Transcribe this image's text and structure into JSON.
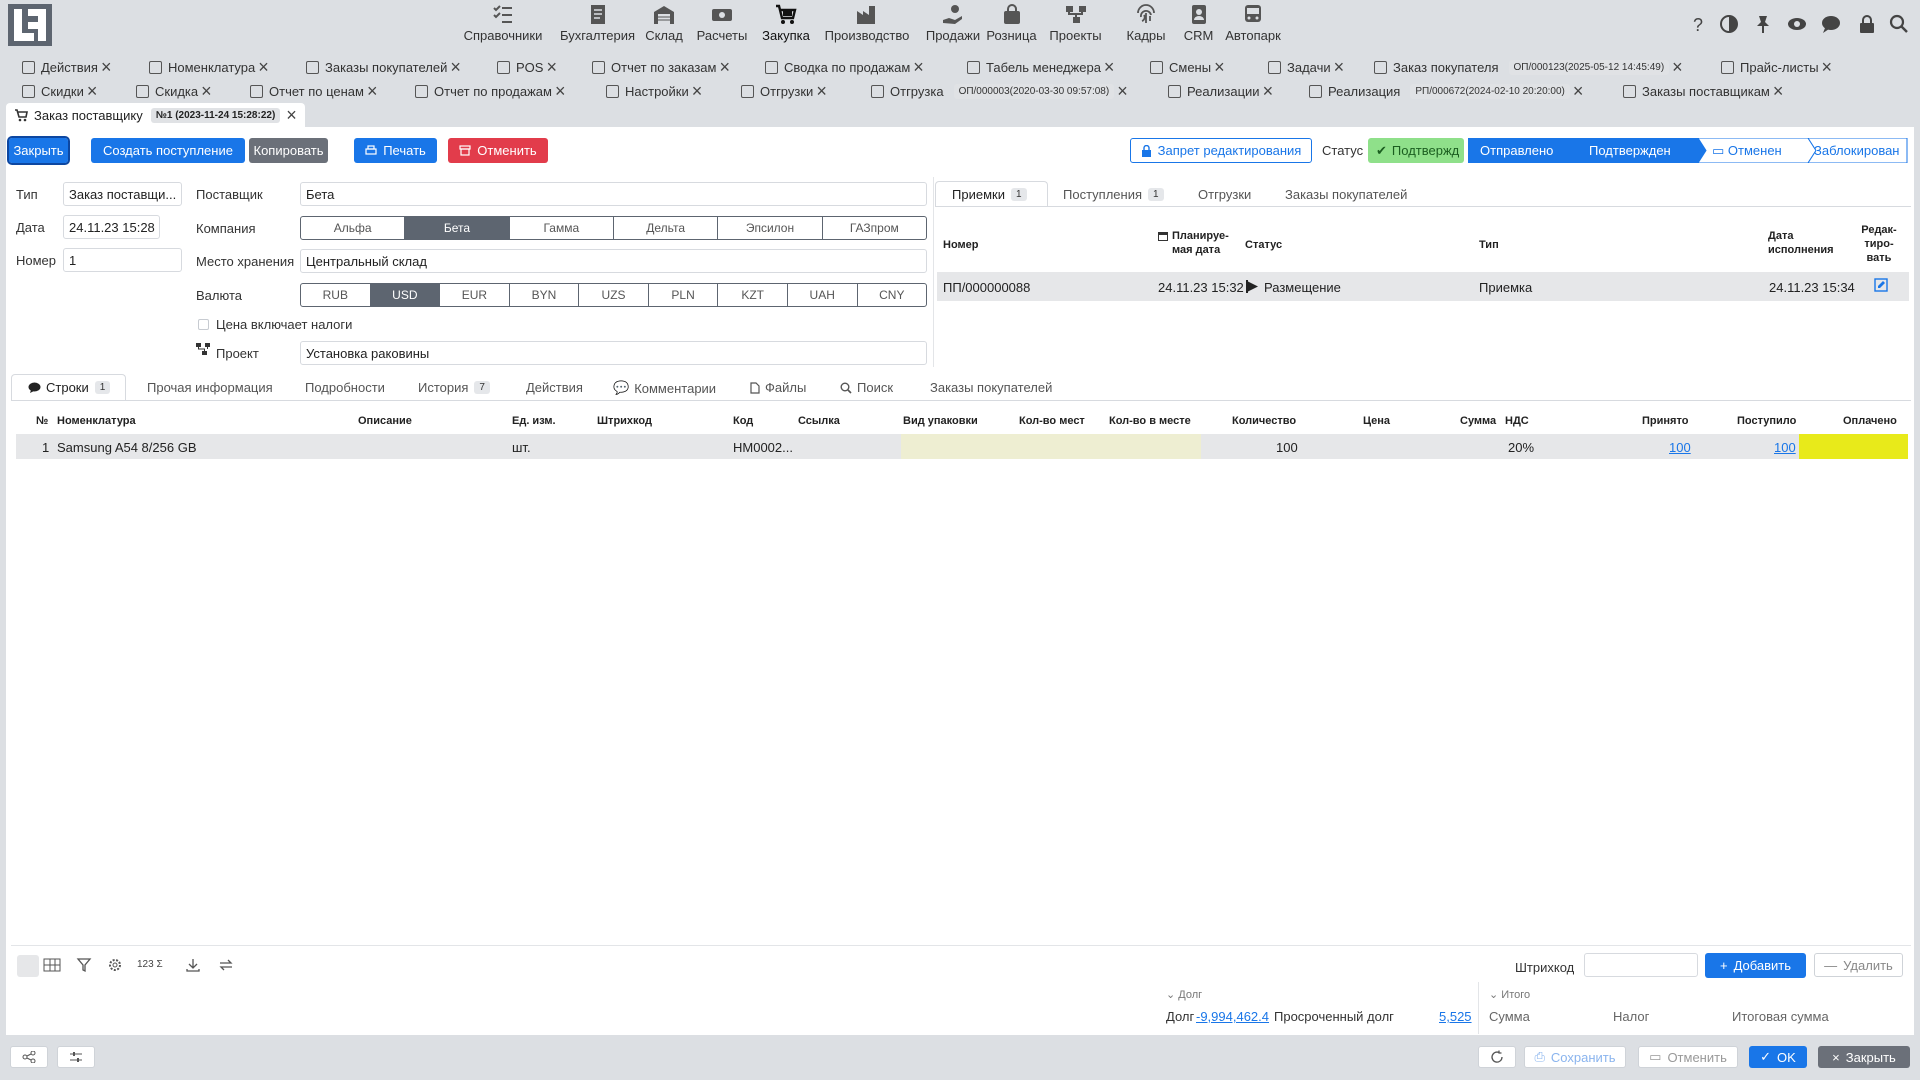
{
  "nav": {
    "items": [
      {
        "label": "Справочники",
        "icon": "list-check-icon"
      },
      {
        "label": "Бухгалтерия",
        "icon": "ledger-icon"
      },
      {
        "label": "Склад",
        "icon": "warehouse-icon"
      },
      {
        "label": "Расчеты",
        "icon": "money-icon"
      },
      {
        "label": "Закупка",
        "icon": "cart-icon"
      },
      {
        "label": "Производство",
        "icon": "factory-icon"
      },
      {
        "label": "Продажи",
        "icon": "hand-money-icon"
      },
      {
        "label": "Розница",
        "icon": "bag-icon"
      },
      {
        "label": "Проекты",
        "icon": "project-icon"
      },
      {
        "label": "Кадры",
        "icon": "fingerprint-icon"
      },
      {
        "label": "CRM",
        "icon": "contact-icon"
      },
      {
        "label": "Автопарк",
        "icon": "bus-icon"
      }
    ]
  },
  "doc_tabs": {
    "row1": [
      {
        "label": "Действия"
      },
      {
        "label": "Номенклатура"
      },
      {
        "label": "Заказы покупателей"
      },
      {
        "label": "POS"
      },
      {
        "label": "Отчет по заказам"
      },
      {
        "label": "Сводка по продажам"
      },
      {
        "label": "Табель менеджера"
      },
      {
        "label": "Смены"
      },
      {
        "label": "Задачи"
      },
      {
        "label": "Заказ покупателя",
        "badge": "ОП/000123(2025-05-12 14:45:49)"
      },
      {
        "label": "Прайс-листы"
      }
    ],
    "row2": [
      {
        "label": "Скидки"
      },
      {
        "label": "Скидка"
      },
      {
        "label": "Отчет по ценам"
      },
      {
        "label": "Отчет по продажам"
      },
      {
        "label": "Настройки"
      },
      {
        "label": "Отгрузки"
      },
      {
        "label": "Отгрузка",
        "badge": "ОП/000003(2020-03-30 09:57:08)"
      },
      {
        "label": "Реализации"
      },
      {
        "label": "Реализация",
        "badge": "РП/000672(2024-02-10 20:20:00)"
      },
      {
        "label": "Заказы поставщикам"
      }
    ],
    "current": {
      "label": "Заказ поставщику",
      "badge": "№1 (2023-11-24 15:28:22)"
    }
  },
  "toolbar": {
    "close": "Закрыть",
    "create_receipt": "Создать поступление",
    "copy": "Копировать",
    "print": "Печать",
    "cancel": "Отменить",
    "edit_lock": "Запрет редактирования",
    "status_label": "Статус",
    "status_value": "Подтвержд",
    "steps": [
      "Отправлено",
      "Подтвержден",
      "Отменен",
      "Заблокирован"
    ]
  },
  "form": {
    "type_label": "Тип",
    "type_value": "Заказ поставщи...",
    "date_label": "Дата",
    "date_value": "24.11.23 15:28",
    "number_label": "Номер",
    "number_value": "1",
    "supplier_label": "Поставщик",
    "supplier_value": "Бета",
    "company_label": "Компания",
    "companies": [
      "Альфа",
      "Бета",
      "Гамма",
      "Дельта",
      "Эпсилон",
      "ГАЗпром"
    ],
    "company_selected": "Бета",
    "storage_label": "Место хранения",
    "storage_value": "Центральный склад",
    "currency_label": "Валюта",
    "currencies": [
      "RUB",
      "USD",
      "EUR",
      "BYN",
      "UZS",
      "PLN",
      "KZT",
      "UAH",
      "CNY"
    ],
    "currency_selected": "USD",
    "tax_included": "Цена включает налоги",
    "project_label": "Проект",
    "project_value": "Установка раковины"
  },
  "right_tabs": [
    {
      "label": "Приемки",
      "count": "1"
    },
    {
      "label": "Поступления",
      "count": "1"
    },
    {
      "label": "Отгрузки"
    },
    {
      "label": "Заказы покупателей"
    }
  ],
  "receipts_table": {
    "headers": {
      "number": "Номер",
      "planned": "Планируе-мая дата",
      "status": "Статус",
      "type": "Тип",
      "exec_date": "Дата исполнения",
      "edit": "Редак-тиро-вать"
    },
    "row": {
      "number": "ПП/000000088",
      "planned": "24.11.23 15:32",
      "status": "Размещение",
      "type": "Приемка",
      "exec_date": "24.11.23 15:34"
    }
  },
  "bottom_tabs": [
    {
      "label": "Строки",
      "count": "1"
    },
    {
      "label": "Прочая информация"
    },
    {
      "label": "Подробности"
    },
    {
      "label": "История",
      "count": "7"
    },
    {
      "label": "Действия"
    },
    {
      "label": "Комментарии"
    },
    {
      "label": "Файлы"
    },
    {
      "label": "Поиск"
    },
    {
      "label": "Заказы покупателей"
    }
  ],
  "lines_table": {
    "headers": {
      "no": "№",
      "item": "Номенклатура",
      "desc": "Описание",
      "unit": "Ед. изм.",
      "barcode": "Штрихкод",
      "code": "Код",
      "link": "Ссылка",
      "pack": "Вид упаковки",
      "places": "Кол-во мест",
      "per_place": "Кол-во в месте",
      "qty": "Количество",
      "price": "Цена",
      "sum": "Сумма",
      "vat": "НДС",
      "accepted": "Принято",
      "received": "Поступило",
      "paid": "Оплачено"
    },
    "row": {
      "no": "1",
      "item": "Samsung A54 8/256 GB",
      "unit": "шт.",
      "code": "HM0002...",
      "qty": "100",
      "vat": "20%",
      "accepted": "100",
      "received": "100"
    }
  },
  "footer": {
    "barcode_label": "Штрихкод",
    "add": "Добавить",
    "delete": "Удалить",
    "debt_section": "Долг",
    "debt_label": "Долг",
    "debt_value": "-9,994,462.4",
    "overdue_label": "Просроченный долг",
    "overdue_value": "5,525",
    "total_section": "Итого",
    "sum_label": "Сумма",
    "tax_label": "Налог",
    "total_label": "Итоговая сумма",
    "toolbar_count": "123 Σ"
  },
  "actions": {
    "save": "Сохранить",
    "cancel": "Отменить",
    "ok": "OK",
    "close": "Закрыть"
  },
  "colors": {
    "accent": "#1976e8",
    "danger": "#e23c4b",
    "segment": "#5d6570",
    "status_green": "#8fe08a",
    "paid_yellow": "#e8ea1a",
    "pack_tint": "#eeeed2"
  }
}
